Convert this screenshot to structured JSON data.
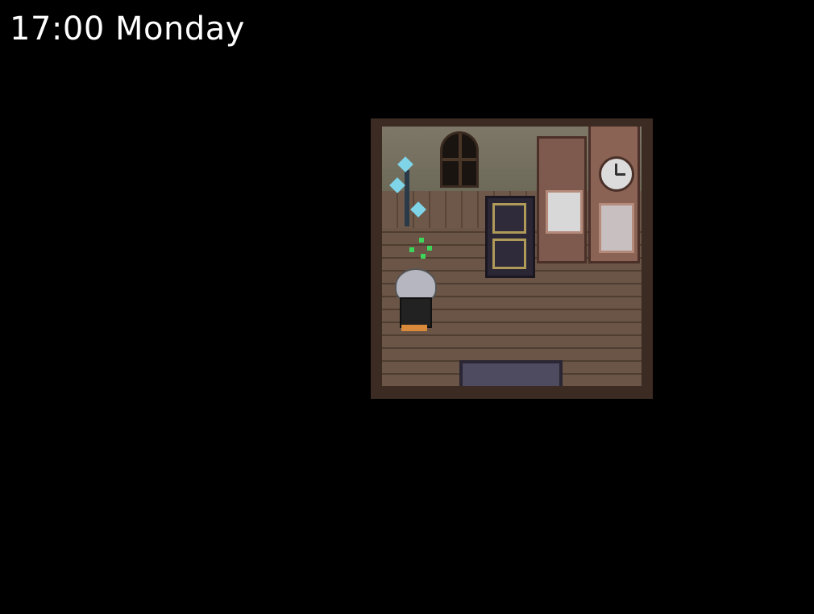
{
  "hud": {
    "time_day": "17:00 Monday"
  },
  "scene": {
    "room": "bedroom",
    "objects": [
      "arched-window",
      "potted-blue-flower-plant",
      "dark-cabinet",
      "wardrobe-with-mirror",
      "grandfather-clock",
      "doormat",
      "player-character",
      "green-sparkle"
    ]
  },
  "colors": {
    "background": "#000000",
    "hud_text": "#ffffff",
    "floor": "#6a5546",
    "wall": "#7e7768"
  }
}
